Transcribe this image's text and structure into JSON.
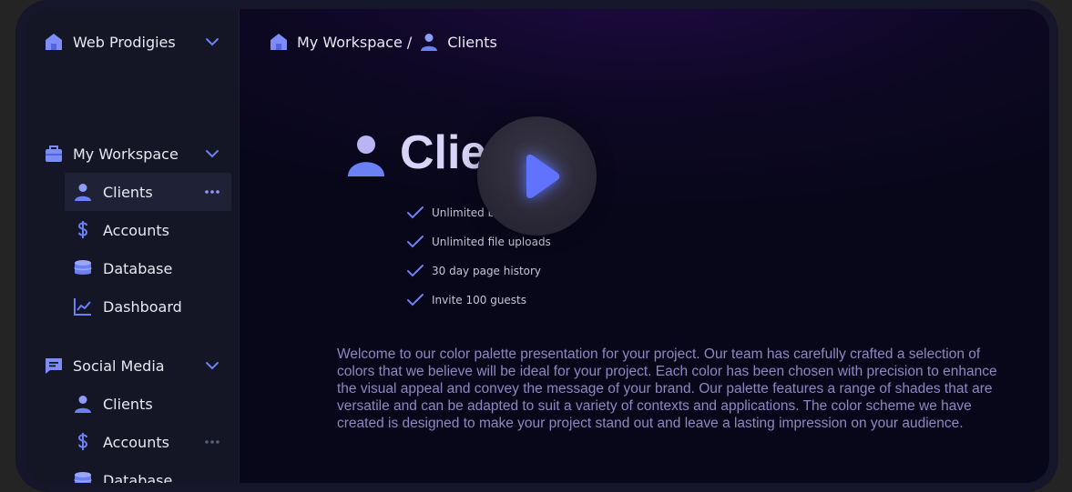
{
  "sidebar": {
    "org": {
      "label": "Web Prodigies",
      "icon": "home-icon"
    },
    "groups": [
      {
        "label": "My Workspace",
        "icon": "briefcase-icon",
        "items": [
          {
            "label": "Clients",
            "icon": "user-icon",
            "active": true
          },
          {
            "label": "Accounts",
            "icon": "dollar-icon"
          },
          {
            "label": "Database",
            "icon": "database-icon"
          },
          {
            "label": "Dashboard",
            "icon": "chart-icon"
          }
        ]
      },
      {
        "label": "Social Media",
        "icon": "message-icon",
        "items": [
          {
            "label": "Clients",
            "icon": "user-icon"
          },
          {
            "label": "Accounts",
            "icon": "dollar-icon"
          },
          {
            "label": "Database",
            "icon": "database-icon"
          }
        ]
      }
    ]
  },
  "breadcrumb": {
    "workspace": "My Workspace",
    "separator": "/",
    "page": "Clients"
  },
  "hero": {
    "title": "Clie",
    "features": [
      "Unlimited b",
      "Unlimited file uploads",
      "30 day page history",
      "Invite 100 guests"
    ]
  },
  "description": "Welcome to our color palette presentation for your project. Our team has carefully crafted a selection of colors that we believe will be ideal for your project. Each color has been chosen with precision to enhance the visual appeal and convey the message of your brand. Our palette features a range of shades that are versatile and can be adapted to suit a variety of contexts and applications. The color scheme we have created is designed to make your project stand out and leave a lasting impression on your audience.",
  "colors": {
    "accent": "#6c80f5",
    "text": "#e8e8f2",
    "description": "#8e86c0",
    "hero_title": "#d8d4f8"
  }
}
